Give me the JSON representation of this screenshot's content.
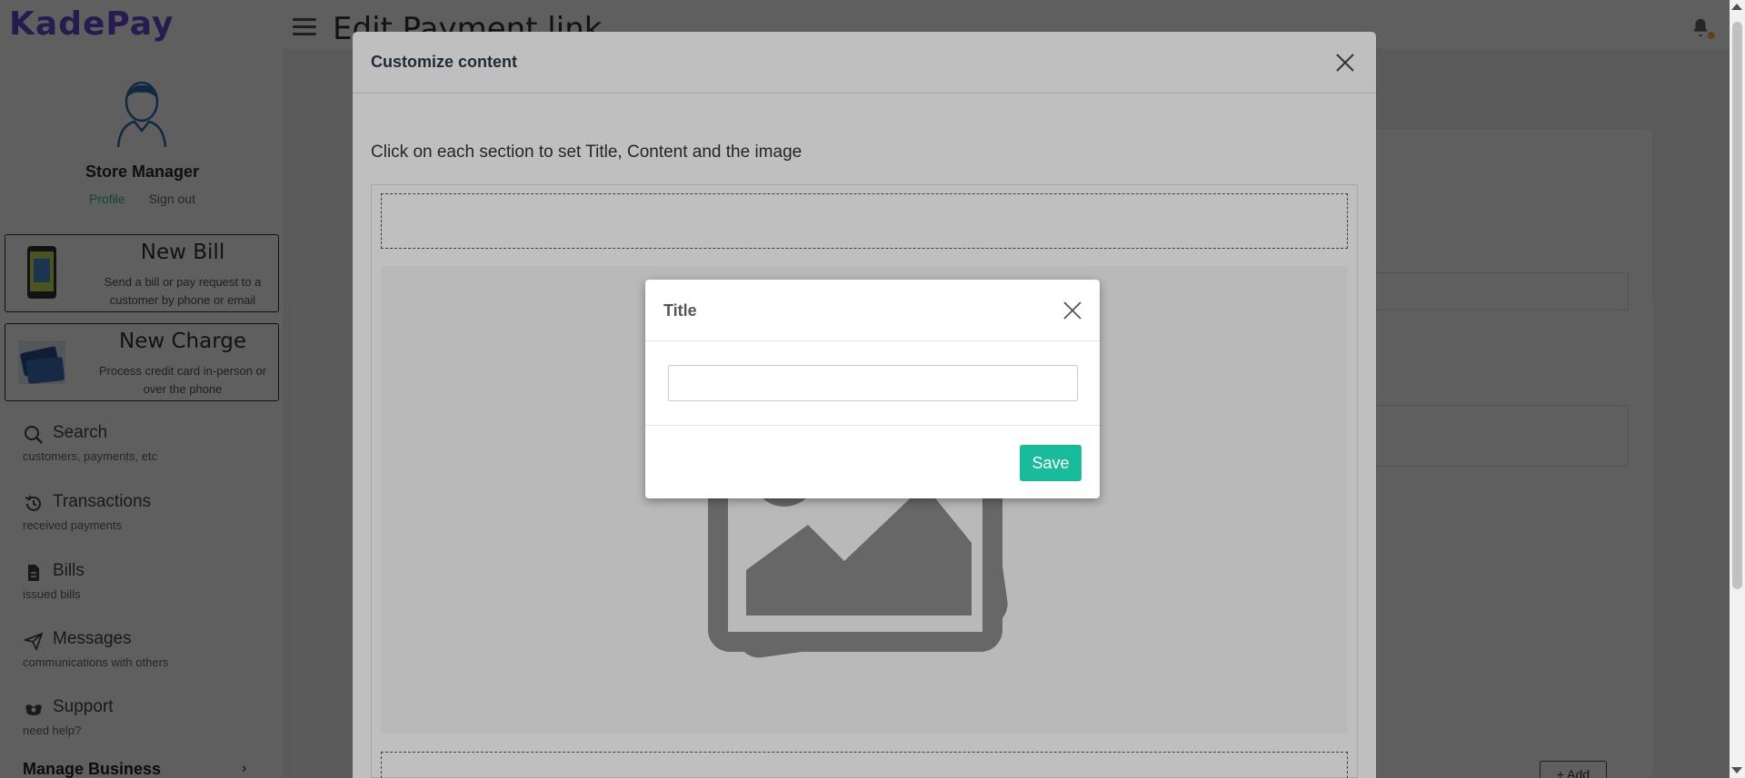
{
  "app": {
    "logo_text": "KadePay",
    "page_title": "Edit Payment link"
  },
  "sidebar": {
    "user_name": "Store Manager",
    "profile_link": "Profile",
    "signout_link": "Sign out",
    "actions": [
      {
        "title": "New Bill",
        "desc": "Send a bill or pay request to a customer by phone or email"
      },
      {
        "title": "New Charge",
        "desc": "Process credit card in-person or over the phone"
      }
    ],
    "nav": [
      {
        "label": "Search",
        "sub": "customers, payments, etc",
        "icon": "search-icon"
      },
      {
        "label": "Transactions",
        "sub": "received payments",
        "icon": "history-icon"
      },
      {
        "label": "Bills",
        "sub": "issued bills",
        "icon": "document-icon"
      },
      {
        "label": "Messages",
        "sub": "communications with others",
        "icon": "send-icon"
      },
      {
        "label": "Support",
        "sub": "need help?",
        "icon": "support-icon"
      }
    ],
    "manage_business": "Manage Business"
  },
  "main": {
    "add_button": "+ Add"
  },
  "customize_modal": {
    "title": "Customize content",
    "instruction": "Click on each section to set Title, Content and the image"
  },
  "title_modal": {
    "title": "Title",
    "input_value": "",
    "save_label": "Save"
  },
  "colors": {
    "accent": "#1abb9c",
    "brand": "#6b4bd6"
  }
}
